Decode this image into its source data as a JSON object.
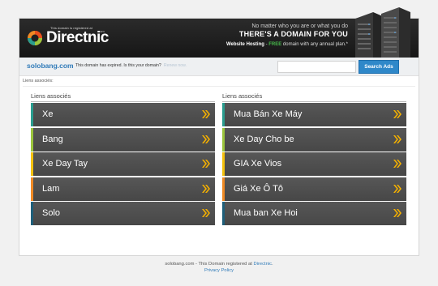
{
  "banner": {
    "registered_note": "This domain is registered at",
    "logo_text": "Directnic",
    "logo_suffix": ".com",
    "slogan_line1": "No matter who you are or what you do",
    "slogan_line2": "THERE'S A DOMAIN FOR YOU",
    "hosting_label": "Website Hosting",
    "hosting_sep": " - ",
    "hosting_free": "FREE",
    "hosting_rest": " domain with any annual plan.*"
  },
  "domainbar": {
    "domain": "solobang.com",
    "expired_text": "This domain has expired. Is this your domain?",
    "renew_text": "Renew now.",
    "search_placeholder": "",
    "search_button": "Search Ads"
  },
  "liens_top": "Liens associés:",
  "columns": [
    {
      "heading": "Liens associés",
      "items": [
        {
          "label": "Xe",
          "accent": "#2a9d8f"
        },
        {
          "label": "Bang",
          "accent": "#9bc53d"
        },
        {
          "label": "Xe Day Tay",
          "accent": "#f4c20d"
        },
        {
          "label": "Lam",
          "accent": "#f08a24"
        },
        {
          "label": "Solo",
          "accent": "#1f5f7a"
        }
      ]
    },
    {
      "heading": "Liens associés",
      "items": [
        {
          "label": "Mua Bán Xe Máy",
          "accent": "#2a9d8f"
        },
        {
          "label": "Xe Day Cho be",
          "accent": "#9bc53d"
        },
        {
          "label": "GIA Xe Vios",
          "accent": "#f4c20d"
        },
        {
          "label": "Giá Xe Ô Tô",
          "accent": "#f08a24"
        },
        {
          "label": "Mua ban Xe Hoi",
          "accent": "#1f5f7a"
        }
      ]
    }
  ],
  "footer": {
    "text_before": "solobang.com - This Domain registered at ",
    "registrar_link": "Directnic",
    "text_after": ".",
    "privacy_link": "Privacy Policy"
  },
  "colors": {
    "arrow": "#f4b000",
    "link_blue": "#2f7ab8",
    "button_blue": "#2f88c9",
    "row_bg": "#4d4d4d"
  }
}
